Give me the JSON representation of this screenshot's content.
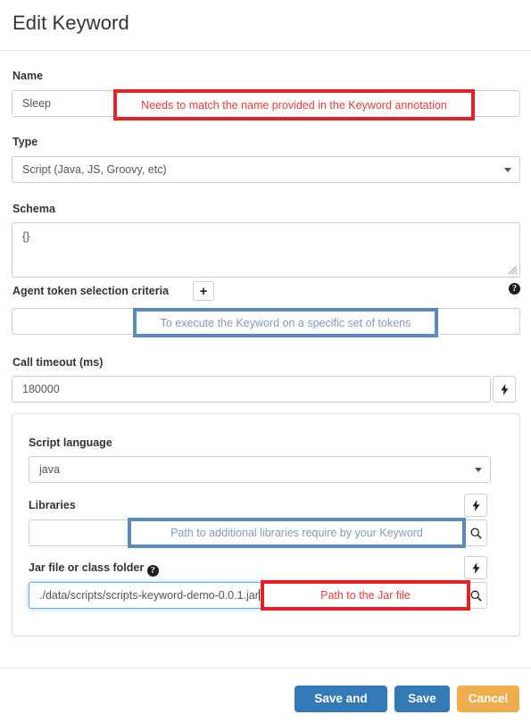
{
  "header": {
    "title": "Edit Keyword"
  },
  "form": {
    "name": {
      "label": "Name",
      "value": "Sleep"
    },
    "type": {
      "label": "Type",
      "value": "Script (Java, JS, Groovy, etc)",
      "caret_icon": "chevron-down-icon"
    },
    "schema": {
      "label": "Schema",
      "value": "{}"
    },
    "agent_token": {
      "label": "Agent token selection criteria",
      "add_label": "+",
      "help_icon": "question-mark-icon",
      "value": ""
    },
    "call_timeout": {
      "label": "Call timeout (ms)",
      "value": "180000",
      "bolt_icon": "lightning-bolt-icon"
    },
    "script_language": {
      "label": "Script language",
      "value": "java",
      "caret_icon": "chevron-down-icon"
    },
    "libraries": {
      "label": "Libraries",
      "value": "",
      "bolt_icon": "lightning-bolt-icon",
      "search_icon": "magnifier-icon"
    },
    "jar_file": {
      "label": "Jar file or class folder",
      "help_icon": "question-mark-icon",
      "value": "./data/scripts/scripts-keyword-demo-0.0.1.jar",
      "bolt_icon": "lightning-bolt-icon",
      "search_icon": "magnifier-icon"
    }
  },
  "annotations": [
    {
      "id": "name-annotation",
      "text": "Needs to match the name provided in the Keyword annotation",
      "color": "#e81f23",
      "text_color": "#ea3c3c",
      "style": "red"
    },
    {
      "id": "agent-token-annotation",
      "text": "To execute the Keyword on a specific set of tokens",
      "color": "#5b8ab9",
      "text_color": "#7d9cc0",
      "style": "blue"
    },
    {
      "id": "libraries-annotation",
      "text": "Path to additional libraries require by your Keyword",
      "color": "#5b8ab9",
      "text_color": "#7d9cc0",
      "style": "blue"
    },
    {
      "id": "jar-file-annotation",
      "text": "Path to the Jar file",
      "color": "#e81f23",
      "text_color": "#ea3c3c",
      "style": "red"
    }
  ],
  "footer": {
    "save_and_edit_label": "Save and edit",
    "save_label": "Save",
    "cancel_label": "Cancel",
    "primary_color": "#337ab7",
    "cancel_color": "#f0ad4e"
  }
}
